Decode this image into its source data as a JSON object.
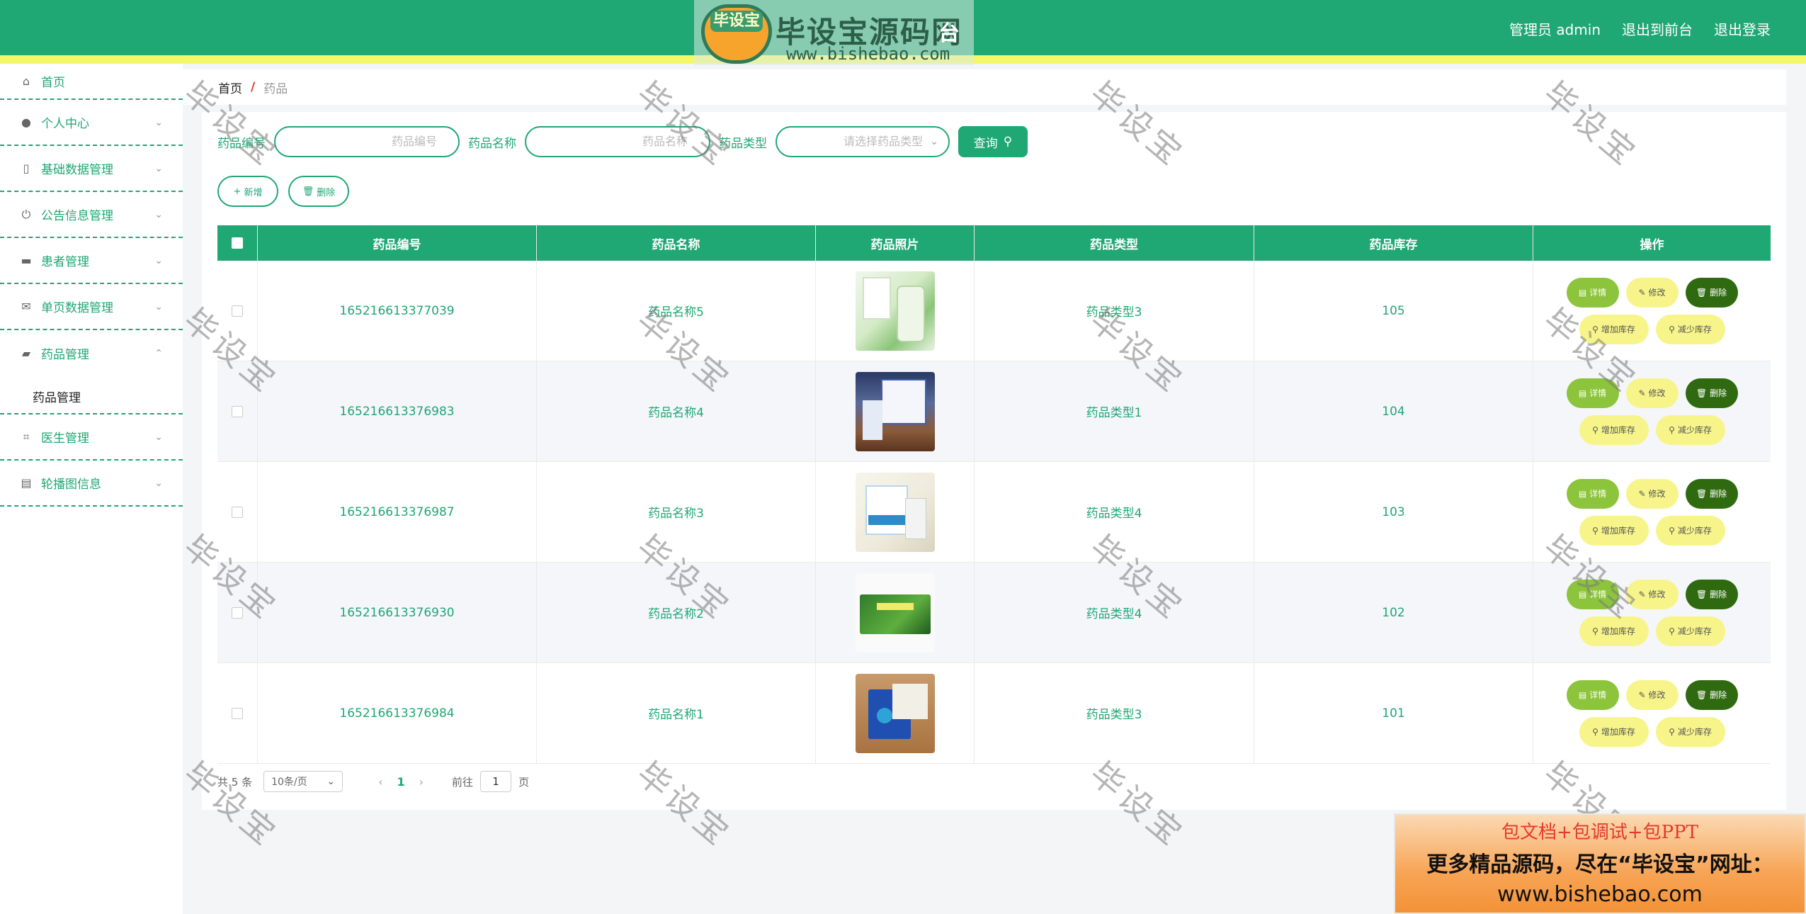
{
  "header": {
    "logo_badge": "毕设宝",
    "logo_title": "毕设宝源码网",
    "logo_title_tail": "台",
    "logo_url": "www.bishebao.com",
    "admin_label": "管理员 admin",
    "to_front_label": "退出到前台",
    "logout_label": "退出登录",
    "color": "#1fa774",
    "stripe_color": "#f4f866"
  },
  "sidebar": {
    "items": [
      {
        "label": "首页",
        "icon": "home-icon"
      },
      {
        "label": "个人中心",
        "icon": "user-icon"
      },
      {
        "label": "基础数据管理",
        "icon": "mic-icon"
      },
      {
        "label": "公告信息管理",
        "icon": "power-icon"
      },
      {
        "label": "患者管理",
        "icon": "monitor-icon"
      },
      {
        "label": "单页数据管理",
        "icon": "mail-icon"
      },
      {
        "label": "药品管理",
        "icon": "ticket-icon"
      },
      {
        "label": "医生管理",
        "icon": "crop-icon"
      },
      {
        "label": "轮播图信息",
        "icon": "clipboard-icon"
      }
    ],
    "submenu": {
      "label": "药品管理"
    }
  },
  "breadcrumb": {
    "home": "首页",
    "separator": "/",
    "current": "药品"
  },
  "search": {
    "code_label": "药品编号",
    "code_placeholder": "药品编号",
    "name_label": "药品名称",
    "name_placeholder": "药品名称",
    "type_label": "药品类型",
    "type_placeholder": "请选择药品类型",
    "query_label": "查询"
  },
  "actions": {
    "add_label": "新增",
    "delete_label": "删除"
  },
  "table": {
    "headers": [
      "药品编号",
      "药品名称",
      "药品照片",
      "药品类型",
      "药品库存",
      "操作"
    ],
    "rows": [
      {
        "code": "165216613377039",
        "name": "药品名称5",
        "type": "药品类型3",
        "stock": "105"
      },
      {
        "code": "165216613376983",
        "name": "药品名称4",
        "type": "药品类型1",
        "stock": "104"
      },
      {
        "code": "165216613376987",
        "name": "药品名称3",
        "type": "药品类型4",
        "stock": "103"
      },
      {
        "code": "165216613376930",
        "name": "药品名称2",
        "type": "药品类型4",
        "stock": "102"
      },
      {
        "code": "165216613376984",
        "name": "药品名称1",
        "type": "药品类型3",
        "stock": "101"
      }
    ],
    "ops": {
      "detail": "详情",
      "edit": "修改",
      "delete": "删除",
      "add_stock": "增加库存",
      "reduce_stock": "减少库存"
    }
  },
  "pagination": {
    "total": "共 5 条",
    "page_size": "10条/页",
    "current_page": "1",
    "goto_label": "前往",
    "goto_value": "1",
    "page_suffix": "页"
  },
  "watermark": "毕设宝",
  "ad": {
    "line1": "包文档+包调试+包PPT",
    "line2": "更多精品源码，尽在“毕设宝”网址：",
    "line3": "www.bishebao.com"
  }
}
